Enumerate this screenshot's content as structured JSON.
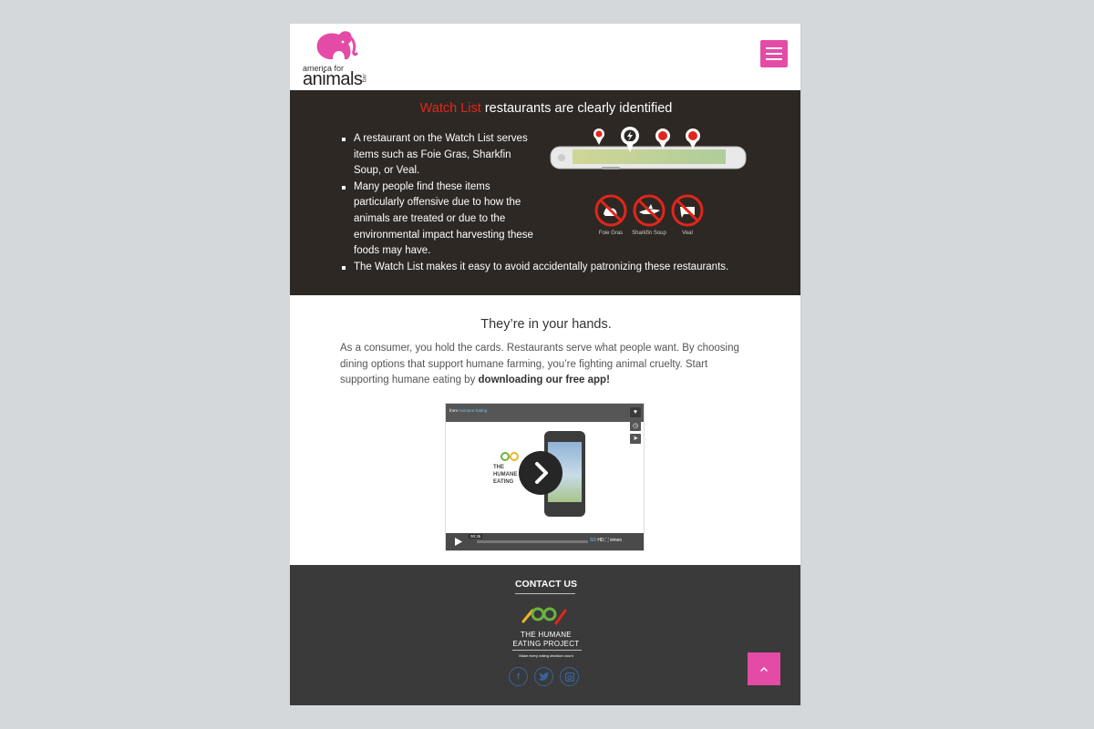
{
  "header": {
    "logo_line1": "america for",
    "logo_line2": "animals",
    "logo_line3": ".org",
    "menu_icon": "hamburger-menu-icon"
  },
  "watchlist": {
    "title_highlight": "Watch List",
    "title_rest": " restaurants are clearly identified",
    "bullets": [
      "A restaurant on the Watch List serves items such as Foie Gras, Sharkfin Soup, or Veal.",
      "Many people find these items particularly offensive due to how the animals are treated or due to the environmental impact harvesting these foods may have.",
      "The Watch List makes it easy to avoid accidentally patronizing these restaurants."
    ],
    "icon_labels": [
      "Foie Gras",
      "Sharkfin Soup",
      "Veal"
    ]
  },
  "hands": {
    "title": "They’re in your hands.",
    "text": "As a consumer, you hold the cards. Restaurants serve what people want. By choosing dining options that support humane farming, you’re fighting animal cruelty. Start supporting humane eating by ",
    "text_bold": "downloading our free app!"
  },
  "video": {
    "from_label": "from",
    "from_source": "Humane Eating",
    "logo_text": "THE HUMANE EATING",
    "time": "00:36",
    "quality_labels": [
      "SD",
      "HD"
    ],
    "provider": "vimeo"
  },
  "footer": {
    "contact": "CONTACT US",
    "org_name_line1": "THE HUMANE",
    "org_name_line2": "EATING PROJECT",
    "tagline": "Make every eating decision count",
    "social": [
      "facebook-icon",
      "twitter-icon",
      "instagram-icon"
    ]
  },
  "colors": {
    "brand_pink": "#e44ba6",
    "band_bg": "#2d2823",
    "watch_red": "#e1261c",
    "footer_bg": "#3a3a3a"
  }
}
